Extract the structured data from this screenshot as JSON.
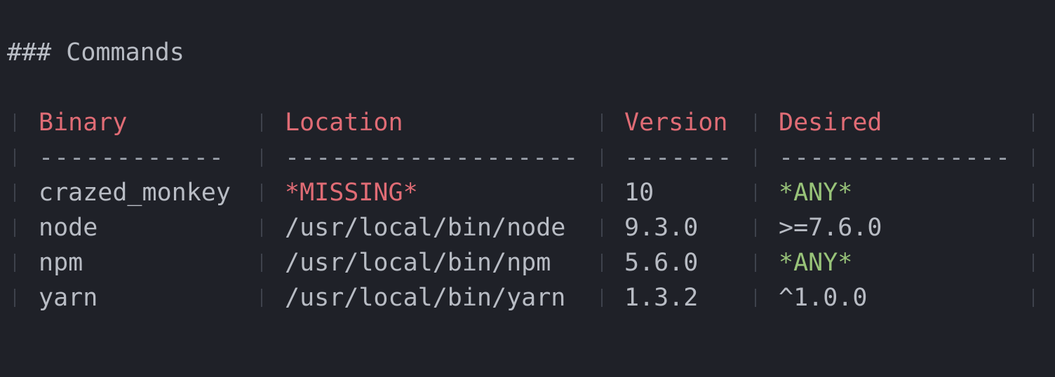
{
  "heading": "### Commands",
  "table": {
    "headers": [
      "Binary",
      "Location",
      "Version",
      "Desired"
    ],
    "dashes": [
      "------------",
      "-------------------",
      "-------",
      "---------------"
    ],
    "rows": [
      [
        "crazed_monkey",
        "*MISSING*",
        "10",
        "*ANY*"
      ],
      [
        "node",
        "/usr/local/bin/node",
        "9.3.0",
        ">=7.6.0"
      ],
      [
        "npm",
        "/usr/local/bin/npm",
        "5.6.0",
        "*ANY*"
      ],
      [
        "yarn",
        "/usr/local/bin/yarn",
        "1.3.2",
        "^1.0.0"
      ]
    ]
  },
  "colors": {
    "background": "#1f2128",
    "text": "#b8bcc4",
    "header": "#e06c75",
    "missing": "#e06c75",
    "any": "#98c379",
    "separator": "#3e424c"
  }
}
